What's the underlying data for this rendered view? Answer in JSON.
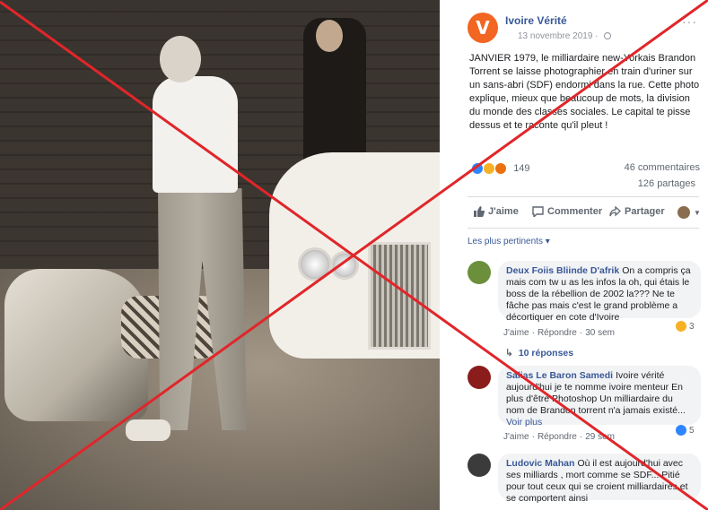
{
  "page": {
    "name": "Ivoire Vérité",
    "logo_letter": "V",
    "date": "13 novembre 2019",
    "brand_color": "#f26522"
  },
  "post": {
    "text": "JANVIER 1979, le milliardaire new-Yorkais Brandon Torrent se laisse photographier en train d'uriner sur un sans-abri (SDF) endormi dans la rue. Cette photo explique, mieux que beaucoup de mots, la division du monde des classes sociales. Le capital te pisse dessus et te raconte qu'il pleut !",
    "reaction_count": "149",
    "reaction_types": [
      "like-icon",
      "sad-icon",
      "angry-icon"
    ],
    "comments_count": "46 commentaires",
    "shares_count": "126 partages"
  },
  "actions": {
    "like_label": "J'aime",
    "comment_label": "Commenter",
    "share_label": "Partager"
  },
  "sort_label": "Les plus pertinents",
  "comments": [
    {
      "author": "Deux Foiis Bliinde D'afrik",
      "text": "On a compris ça mais com tw u as les infos la oh, qui étais le boss de la rébellion de 2002 la??? Ne te fâche pas mais c'est le grand problème a décortiquer en cote d'Ivoire",
      "like_label": "J'aime",
      "reply_label": "Répondre",
      "time": "30 sem",
      "reaction_count": "3",
      "avatar_color": "#6b8f3a"
    },
    {
      "author": "Salias Le Baron Samedi",
      "text": "Ivoire vérité aujourd'hui je te nomme ivoire menteur En plus d'être Photoshop Un milliardaire du nom de Brandon torrent n'a jamais existé",
      "more_label": "Voir plus",
      "like_label": "J'aime",
      "reply_label": "Répondre",
      "time": "29 sem",
      "reaction_count": "5",
      "avatar_color": "#8b1c1c"
    },
    {
      "author": "Ludovic Mahan",
      "text": "Où il est aujourd'hui avec ses milliards , mort comme se SDF... Pitié pour tout ceux qui se croient milliardaires et se comportent ainsi",
      "avatar_color": "#3b3b3b"
    }
  ],
  "replies_label": "10 réponses",
  "overlay_color": "#e0262a"
}
